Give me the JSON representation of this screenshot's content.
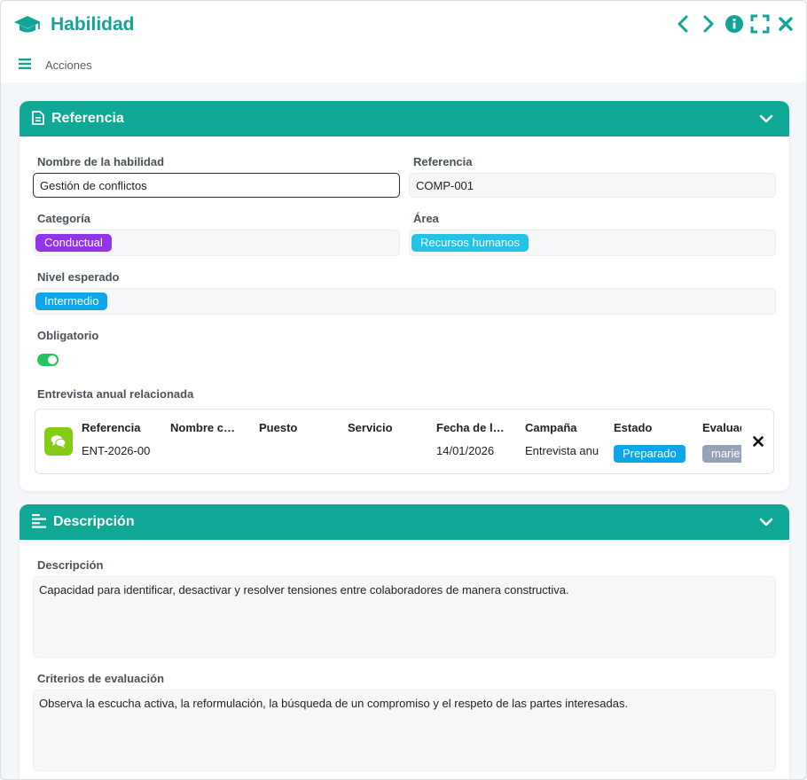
{
  "window": {
    "title": "Habilidad",
    "actions_label": "Acciones",
    "icons": [
      "graduation-cap-icon",
      "chevron-left-icon",
      "chevron-right-icon",
      "info-icon",
      "fullscreen-icon",
      "close-icon",
      "menu-icon"
    ],
    "accent_color": "#12a597"
  },
  "referencia_panel": {
    "title": "Referencia",
    "fields": {
      "nombre": {
        "label": "Nombre de la habilidad",
        "value": "Gestión de conflictos"
      },
      "referencia": {
        "label": "Referencia",
        "value": "COMP-001"
      },
      "categoria": {
        "label": "Categoría",
        "value": "Conductual",
        "color": "#9333ea"
      },
      "area": {
        "label": "Área",
        "value": "Recursos humanos",
        "color": "#22c3e6"
      },
      "nivel": {
        "label": "Nivel esperado",
        "value": "Intermedio",
        "color": "#0ea5e9"
      },
      "obligatorio": {
        "label": "Obligatorio",
        "checked": true,
        "color": "#22c55e"
      }
    },
    "entrevista": {
      "label": "Entrevista anual relacionada",
      "columns": [
        "Referencia",
        "Nombre c…",
        "Puesto",
        "Servicio",
        "Fecha de l…",
        "Campaña",
        "Estado",
        "Evaluad"
      ],
      "row": {
        "referencia": "ENT-2026-00",
        "nombre": "",
        "puesto": "",
        "servicio": "",
        "fecha": "14/01/2026",
        "campana": "Entrevista anu",
        "estado": "Preparado",
        "evaluador": "marie"
      },
      "estado_color": "#0ea5e9",
      "evaluador_color": "#94a3b8"
    }
  },
  "descripcion_panel": {
    "title": "Descripción",
    "fields": {
      "descripcion": {
        "label": "Descripción",
        "value": "Capacidad para identificar, desactivar y resolver tensiones entre colaboradores de manera constructiva."
      },
      "criterios": {
        "label": "Criterios de evaluación",
        "value": "Observa la escucha activa, la reformulación, la búsqueda de un compromiso y el respeto de las partes interesadas."
      }
    }
  }
}
